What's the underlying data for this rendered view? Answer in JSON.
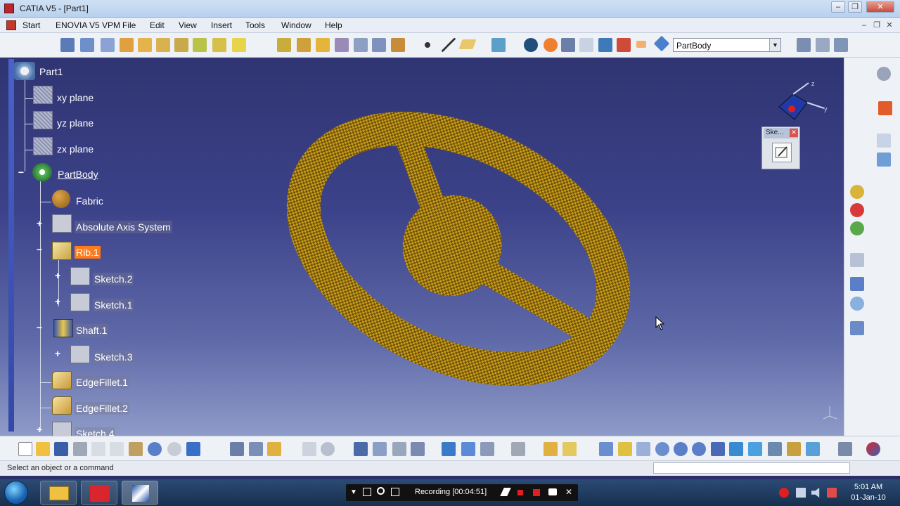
{
  "window": {
    "title": "CATIA V5 - [Part1]"
  },
  "menu": {
    "items": [
      "Start",
      "ENOVIA V5 VPM",
      "File",
      "Edit",
      "View",
      "Insert",
      "Tools",
      "Window",
      "Help"
    ]
  },
  "toolbar": {
    "body_select_value": "PartBody"
  },
  "tree": {
    "root": "Part1",
    "xy_plane": "xy plane",
    "yz_plane": "yz plane",
    "zx_plane": "zx plane",
    "partbody": "PartBody",
    "fabric": "Fabric",
    "axis_system": "Absolute Axis System",
    "rib": "Rib.1",
    "sketch2": "Sketch.2",
    "sketch1": "Sketch.1",
    "shaft": "Shaft.1",
    "sketch3": "Sketch.3",
    "edgefillet1": "EdgeFillet.1",
    "edgefillet2": "EdgeFillet.2",
    "sketch4": "Sketch.4"
  },
  "palette": {
    "title": "Ske..."
  },
  "status": {
    "text": "Select an object or a command"
  },
  "taskbar": {
    "recording": "Recording [00:04:51]",
    "time": "5:01 AM",
    "date": "01-Jan-10"
  },
  "colors": {
    "selected_node": "#ff7a1a",
    "viewport_top": "#2f3472",
    "viewport_bottom": "#8e9bc8",
    "fabric": "#a07a10"
  }
}
